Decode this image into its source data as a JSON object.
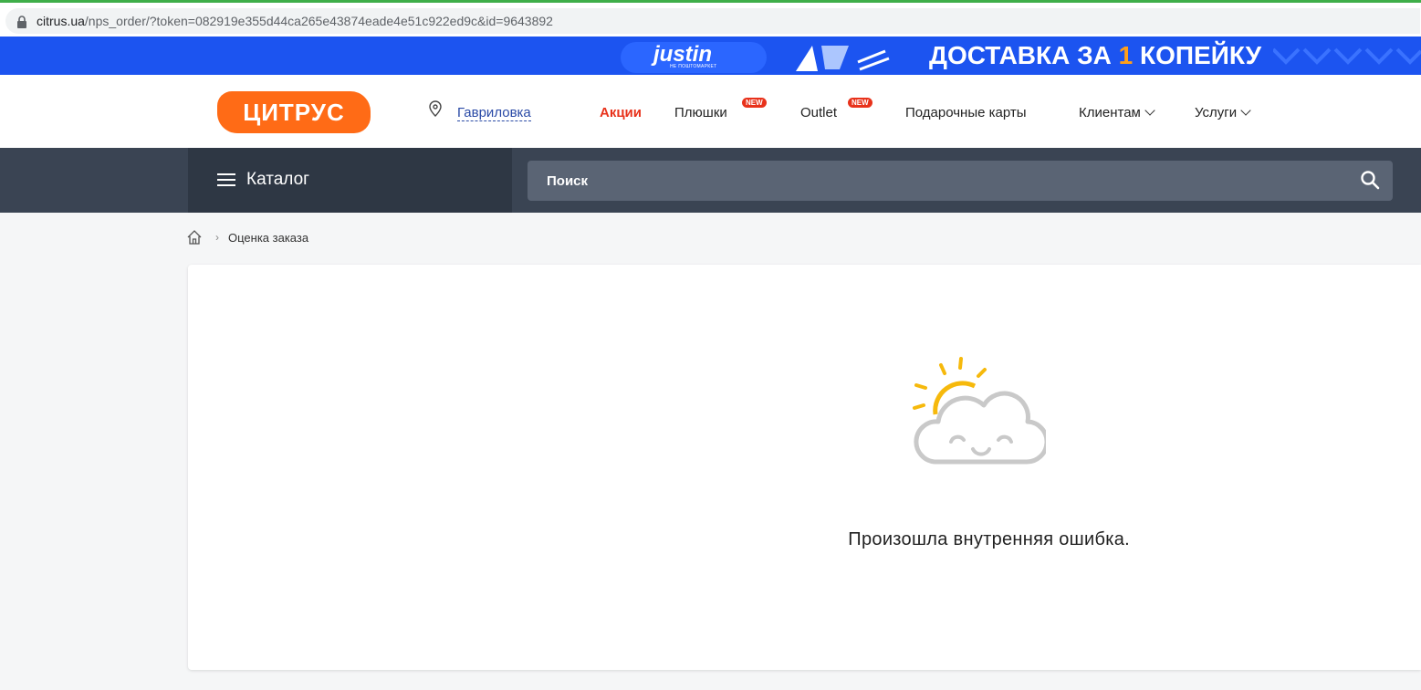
{
  "browser": {
    "url_domain": "citrus.ua",
    "url_path": "/nps_order/?token=082919e355d44ca265e43874eade4e51c922ed9c&id=9643892"
  },
  "banner": {
    "brand": "justin",
    "brand_sub": "НЕ ПОШТОМАРКЕТ",
    "promo_prefix": "ДОСТАВКА ЗА ",
    "promo_highlight": "1",
    "promo_suffix": " КОПЕЙКУ",
    "colors": {
      "background": "#1c54f0",
      "highlight": "#ff9f1a"
    }
  },
  "header": {
    "logo": "ЦИТРУС",
    "city": "Гавриловка",
    "nav": {
      "promo": "Акции",
      "plushki": "Плюшки",
      "plushki_badge": "NEW",
      "outlet": "Outlet",
      "outlet_badge": "NEW",
      "gift_cards": "Подарочные карты",
      "clients": "Клиентам",
      "services": "Услуги"
    },
    "colors": {
      "logo": "#ff6b16",
      "promo": "#e8321b"
    }
  },
  "toolbar": {
    "catalog_label": "Каталог",
    "search_placeholder": "Поиск"
  },
  "breadcrumb": {
    "current": "Оценка заказа"
  },
  "main": {
    "error_message": "Произошла внутренняя ошибка.",
    "illustration": "sun-cloud-icon"
  }
}
